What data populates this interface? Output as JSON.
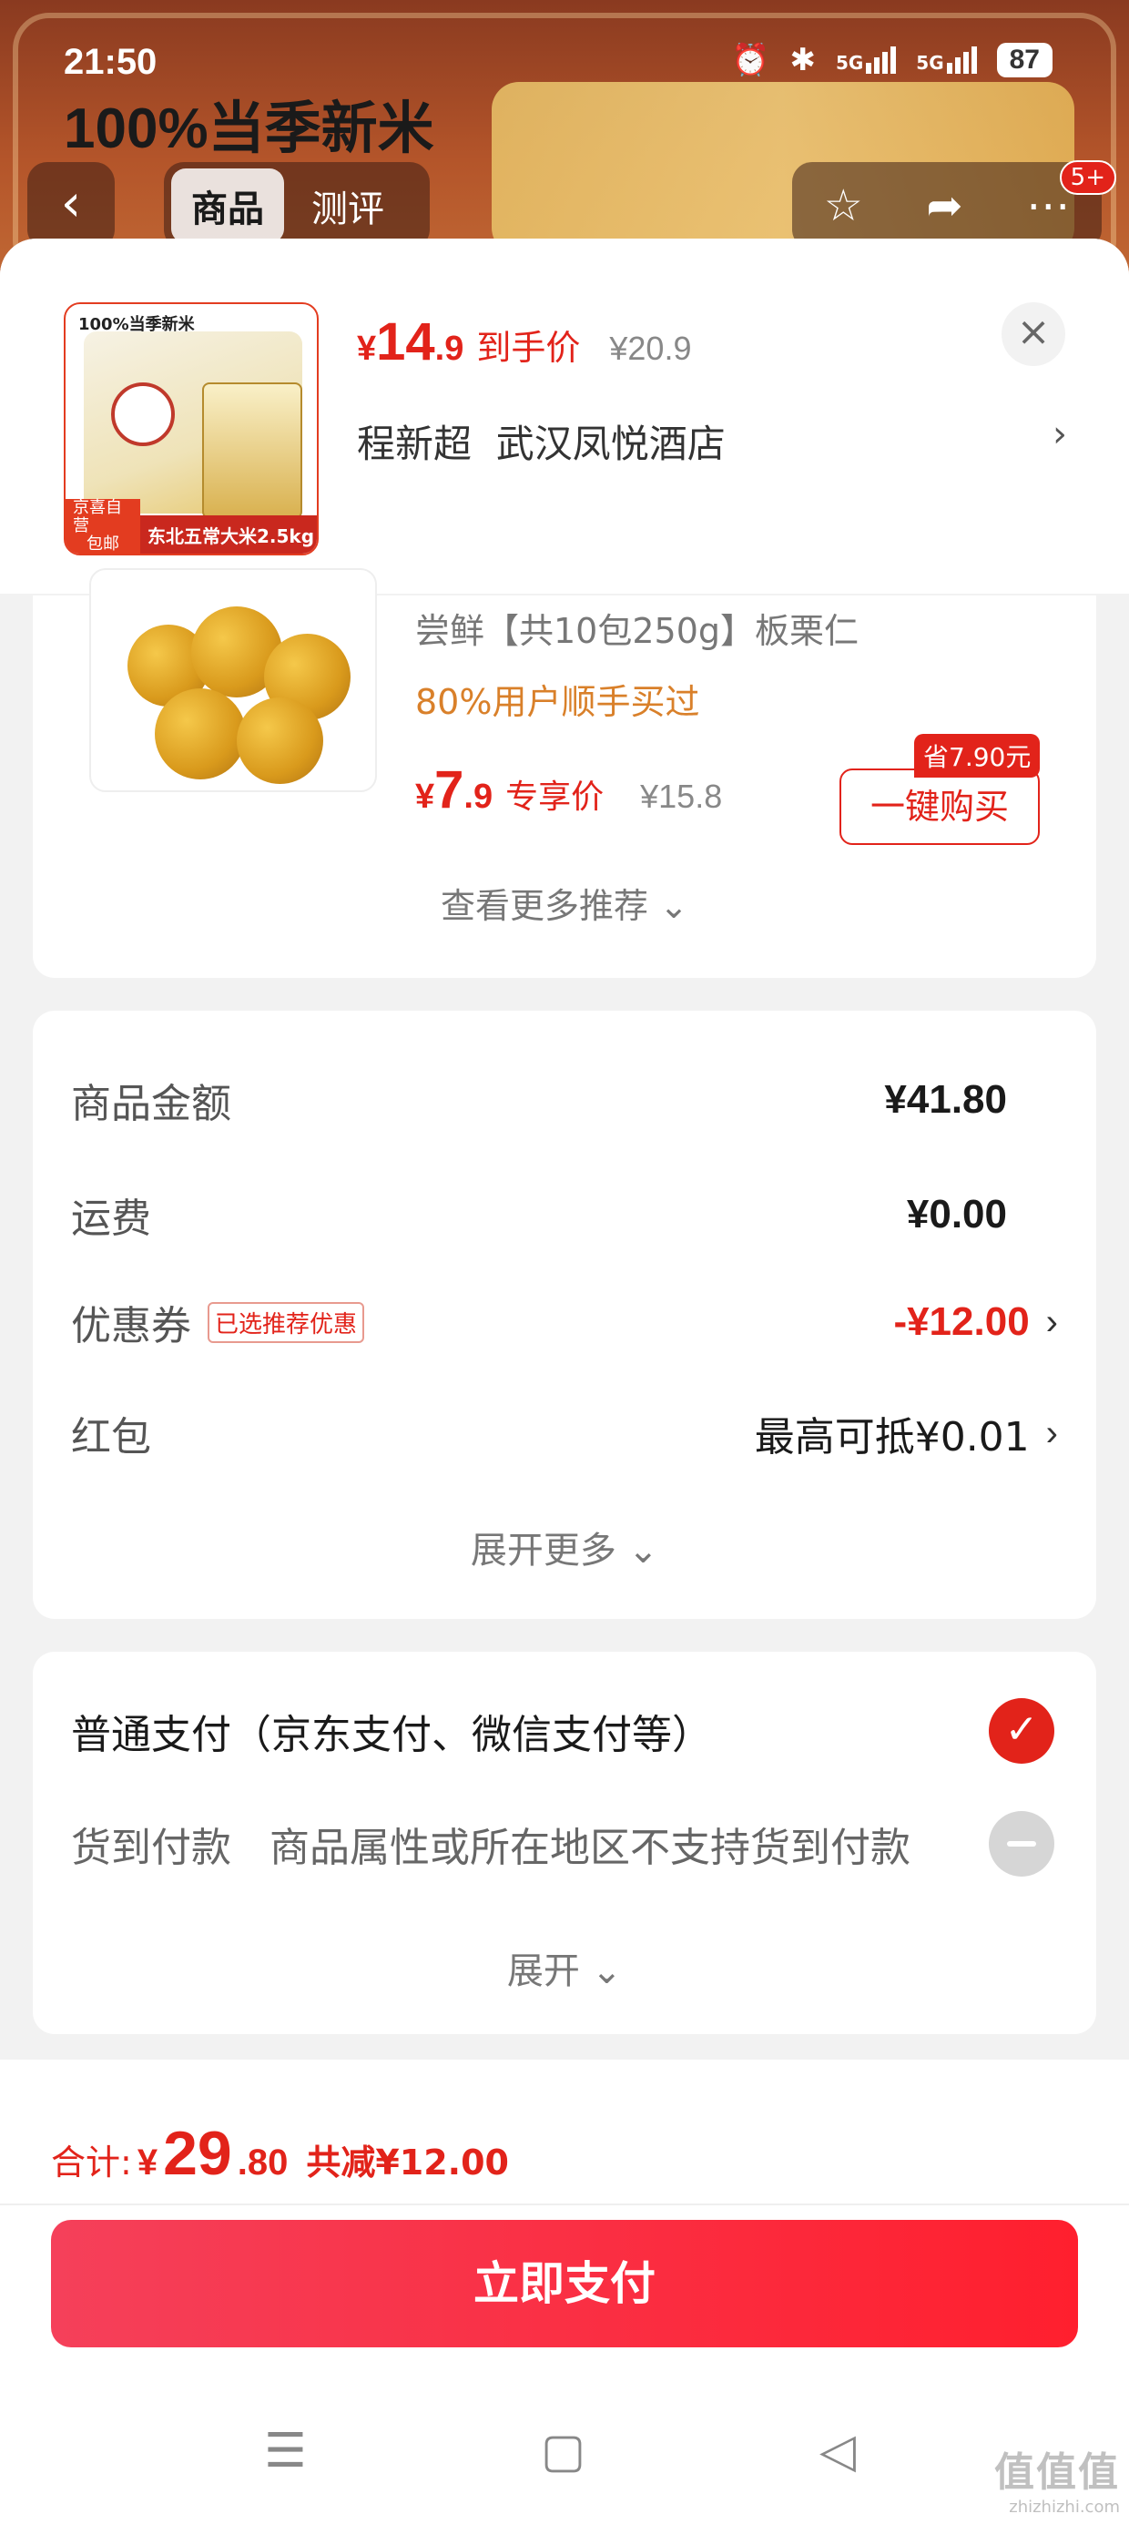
{
  "status_bar": {
    "time": "21:50",
    "signal_1": "5G",
    "signal_2": "5G",
    "battery": "87"
  },
  "background_page": {
    "headline": "100%当季新米",
    "back_icon": "chevron-left-icon",
    "tabs": [
      {
        "label": "商品",
        "active": true
      },
      {
        "label": "测评",
        "active": false
      }
    ],
    "badge": "5+"
  },
  "sheet_header": {
    "thumb": {
      "title": "100%当季新米",
      "ship_label_1": "京喜自营",
      "ship_label_2": "包邮",
      "desc": "东北五常大米2.5kg"
    },
    "price": {
      "yen": "¥",
      "int": "14",
      "dec": ".9"
    },
    "price_label": "到手价",
    "original_price": "¥20.9",
    "address": "程新超  武汉凤悦酒店",
    "address_arrow": "›",
    "close": "×"
  },
  "recommend": {
    "name": "尝鲜【共10包250g】板栗仁",
    "bought": "80%用户顺手买过",
    "price": {
      "yen": "¥",
      "int": "7",
      "dec": ".9"
    },
    "price_label": "专享价",
    "original_price": "¥15.8",
    "save_tag": "省7.90元",
    "buy_button": "一键购买",
    "more": "查看更多推荐 ⌄"
  },
  "amounts": {
    "rows": [
      {
        "label": "商品金额",
        "value": "¥41.80"
      },
      {
        "label": "运费",
        "value": "¥0.00"
      },
      {
        "label": "优惠券",
        "tag": "已选推荐优惠",
        "value": "-¥12.00",
        "arrow": "›"
      },
      {
        "label": "红包",
        "value": "最高可抵¥0.01",
        "arrow": "›"
      }
    ],
    "expand": "展开更多 ⌄"
  },
  "payment": {
    "standard": "普通支付（京东支付、微信支付等）",
    "cod": "货到付款   商品属性或所在地区不支持货到付款",
    "expand": "展开 ⌄",
    "check_mark": "✓"
  },
  "bottom": {
    "total_label": "合计:",
    "total": {
      "yen": "¥",
      "int": "29",
      "dec": ".80"
    },
    "saved": "共减¥12.00",
    "pay_button": "立即支付"
  },
  "system_nav": {
    "menu": "☰",
    "home": "▢",
    "back": "◁"
  },
  "watermark": {
    "big": "值值值",
    "small": "zhizhizhi.com"
  },
  "colors": {
    "accent_red": "#e2231a",
    "orange_text": "#d9802a",
    "pay_button_gradient_start": "#f5405a",
    "pay_button_gradient_end": "#ff1f2e"
  }
}
